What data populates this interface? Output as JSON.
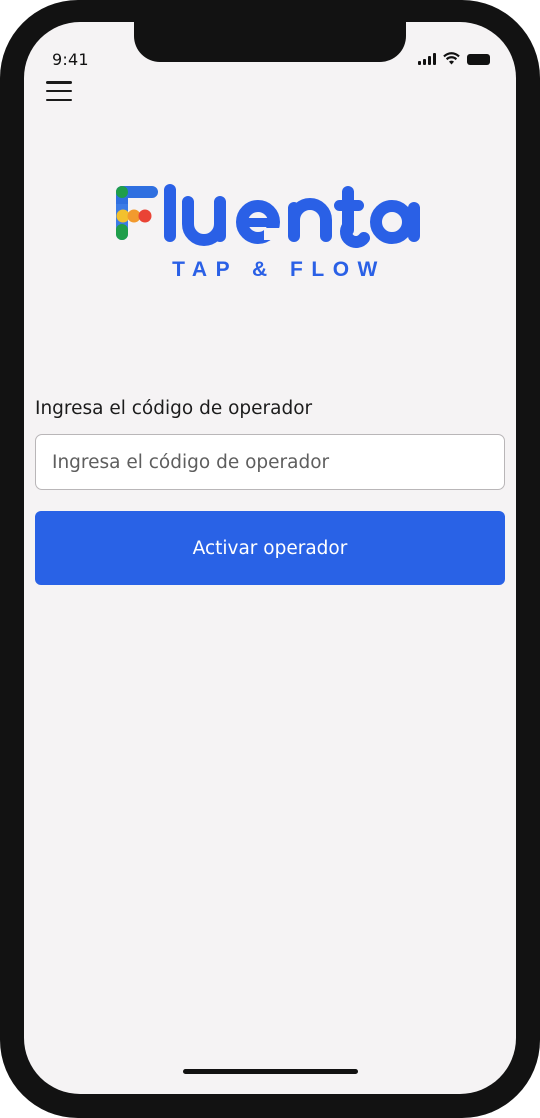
{
  "status_bar": {
    "time": "9:41",
    "icons": [
      "cellular-signal-icon",
      "wifi-icon",
      "battery-icon"
    ]
  },
  "header": {
    "menu_icon": "hamburger-menu-icon"
  },
  "brand": {
    "name": "Fluenta",
    "tagline": "TAP & FLOW",
    "primary_color": "#2a60e6",
    "f_stem_colors": [
      "#1f9e4a",
      "#f2c12e",
      "#ea4335",
      "#3b7be6"
    ]
  },
  "form": {
    "label": "Ingresa el código de operador",
    "input_placeholder": "Ingresa el código de operador",
    "input_value": "",
    "submit_label": "Activar operador"
  },
  "colors": {
    "screen_background": "#f5f3f4",
    "button_background": "#2962e6",
    "button_text": "#ffffff",
    "frame": "#121212"
  }
}
